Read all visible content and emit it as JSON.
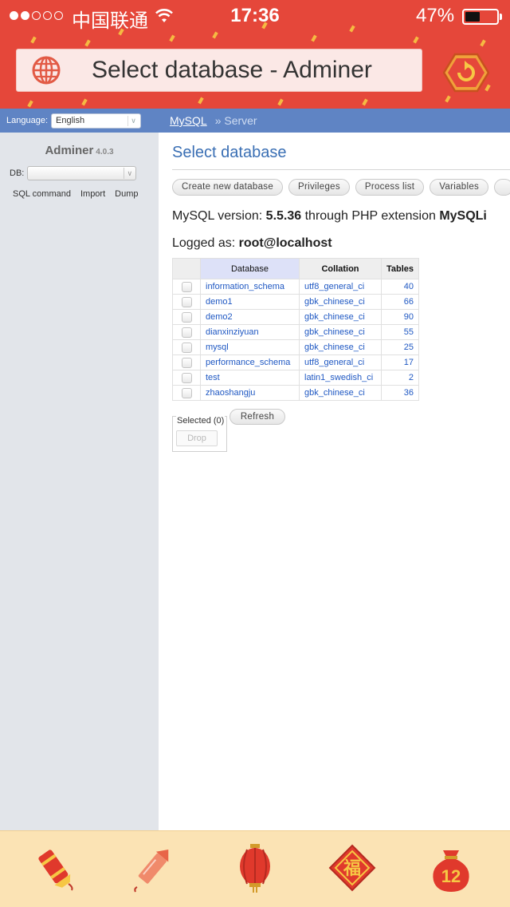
{
  "status_bar": {
    "carrier": "中国联通",
    "time": "17:36",
    "battery_percent": "47%",
    "battery_level": 0.47,
    "signal_bars": 2,
    "signal_total": 5
  },
  "browser": {
    "title": "Select database - Adminer",
    "globe_icon": "globe-icon",
    "reload_icon": "reload-icon"
  },
  "adminer_header": {
    "language_label": "Language:",
    "language_value": "English",
    "breadcrumb_link": "MySQL",
    "breadcrumb_current": "» Server"
  },
  "sidebar": {
    "brand": "Adminer",
    "version": "4.0.3",
    "db_label": "DB:",
    "links": [
      "SQL command",
      "Import",
      "Dump"
    ]
  },
  "main": {
    "heading": "Select database",
    "links": [
      "Create new database",
      "Privileges",
      "Process list",
      "Variables"
    ],
    "version_prefix": "MySQL version: ",
    "version_value": "5.5.36",
    "version_middle": " through PHP extension ",
    "version_ext": "MySQLi",
    "logged_prefix": "Logged as: ",
    "logged_user": "root@localhost",
    "table": {
      "headers": [
        "Database",
        "Collation",
        "Tables"
      ],
      "rows": [
        [
          "information_schema",
          "utf8_general_ci",
          "40"
        ],
        [
          "demo1",
          "gbk_chinese_ci",
          "66"
        ],
        [
          "demo2",
          "gbk_chinese_ci",
          "90"
        ],
        [
          "dianxinziyuan",
          "gbk_chinese_ci",
          "55"
        ],
        [
          "mysql",
          "gbk_chinese_ci",
          "25"
        ],
        [
          "performance_schema",
          "utf8_general_ci",
          "17"
        ],
        [
          "test",
          "latin1_swedish_ci",
          "2"
        ],
        [
          "zhaoshangju",
          "gbk_chinese_ci",
          "36"
        ]
      ]
    },
    "selected_label": "Selected (0)",
    "drop_label": "Drop",
    "refresh_label": "Refresh"
  },
  "bottom_bar": {
    "icons": [
      "firecracker-icon",
      "rocket-firework-icon",
      "lantern-icon",
      "fu-diamond-icon",
      "lucky-bag-icon"
    ],
    "lucky_bag_number": "12",
    "fu_char": "福"
  },
  "colors": {
    "header_red": "#e5473a",
    "adminer_blue": "#5f84c4",
    "link_blue": "#1f58c3",
    "bottom_bar": "#fbe3b4"
  }
}
